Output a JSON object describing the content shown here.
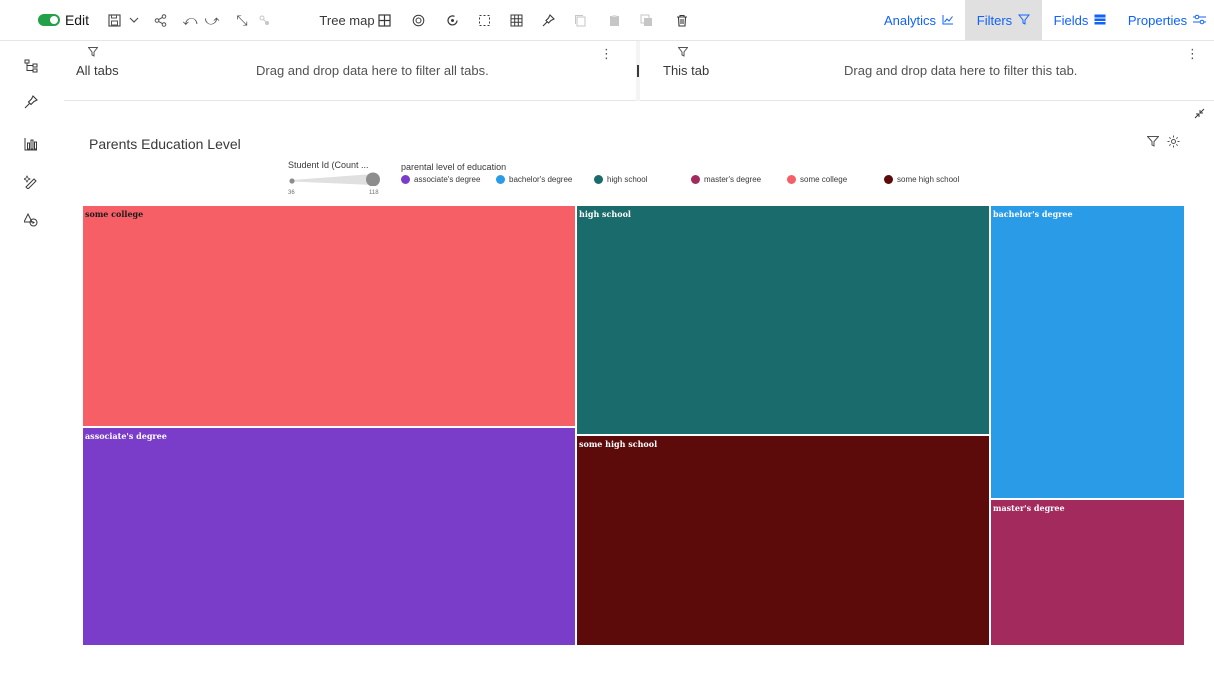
{
  "toolbar": {
    "edit_label": "Edit",
    "visualization_label": "Tree map",
    "analytics_label": "Analytics",
    "filters_label": "Filters",
    "fields_label": "Fields",
    "properties_label": "Properties",
    "icons": [
      "edit-toggle",
      "save-icon",
      "chevron-down-icon",
      "share-icon",
      "undo-icon",
      "redo-icon",
      "collapse-icon",
      "linked-icon",
      "treemap-icon",
      "target-icon",
      "refresh-icon",
      "select-icon",
      "table-icon",
      "pin-icon",
      "copy-icon",
      "paste-icon",
      "duplicate-icon",
      "delete-icon"
    ]
  },
  "rail": {
    "icons": [
      "hierarchy-icon",
      "pin-icon",
      "chart-icon",
      "magic-icon",
      "shapes-icon"
    ]
  },
  "filters": {
    "all_tabs": {
      "name": "All tabs",
      "hint": "Drag and drop data here to filter all tabs."
    },
    "this_tab": {
      "name": "This tab",
      "hint": "Drag and drop data here to filter this tab."
    }
  },
  "visualization": {
    "title": "Parents Education Level"
  },
  "size_legend": {
    "title": "Student Id (Count ...",
    "min": "36",
    "max": "118"
  },
  "color_legend": {
    "title": "parental level of education",
    "items": [
      {
        "label": "associate's degree",
        "color": "#7a3dc9"
      },
      {
        "label": "bachelor's degree",
        "color": "#2a9be6"
      },
      {
        "label": "high school",
        "color": "#1a6b6b"
      },
      {
        "label": "master's degree",
        "color": "#a32a5d"
      },
      {
        "label": "some college",
        "color": "#f65f65"
      },
      {
        "label": "some high school",
        "color": "#5c0a0a"
      }
    ]
  },
  "chart_data": {
    "type": "treemap",
    "size_measure": "Student Id (Count ...",
    "color_by": "parental level of education",
    "size_range": [
      36,
      118
    ],
    "categories": [
      "some college",
      "associate's degree",
      "high school",
      "some high school",
      "bachelor's degree",
      "master's degree"
    ],
    "values": [
      226,
      222,
      196,
      179,
      118,
      59
    ],
    "colors": [
      "#f65f65",
      "#7a3dc9",
      "#1a6b6b",
      "#5c0a0a",
      "#2a9be6",
      "#a32a5d"
    ],
    "label_colors": [
      "#1a1a1a",
      "#ffffff",
      "#ffffff",
      "#ffffff",
      "#ffffff",
      "#ffffff"
    ]
  }
}
